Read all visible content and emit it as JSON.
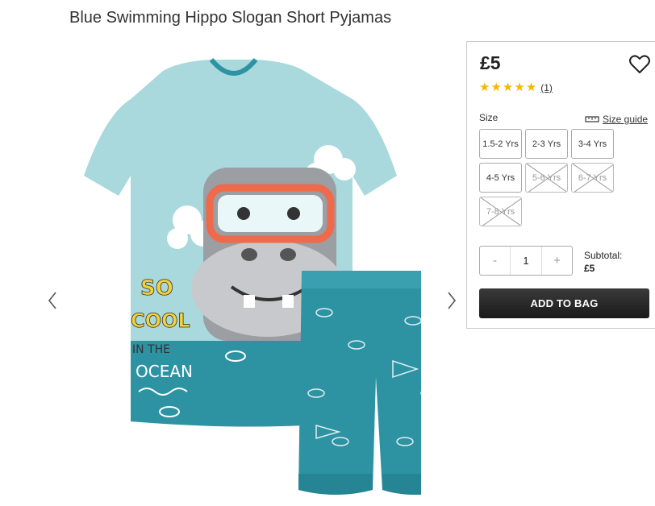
{
  "product": {
    "title": "Blue Swimming Hippo Slogan Short Pyjamas",
    "price": "£5",
    "rating": {
      "stars": 5,
      "review_count": "(1)"
    },
    "size_label": "Size",
    "size_guide_label": "Size guide",
    "sizes": [
      {
        "label": "1.5-2 Yrs",
        "available": true
      },
      {
        "label": "2-3 Yrs",
        "available": true
      },
      {
        "label": "3-4 Yrs",
        "available": true
      },
      {
        "label": "4-5 Yrs",
        "available": true
      },
      {
        "label": "5-6 Yrs",
        "available": false
      },
      {
        "label": "6-7 Yrs",
        "available": false
      },
      {
        "label": "7-8 Yrs",
        "available": false
      }
    ],
    "quantity": {
      "minus": "-",
      "value": "1",
      "plus": "+"
    },
    "subtotal_label": "Subtotal:",
    "subtotal_value": "£5",
    "add_to_bag_label": "ADD TO BAG"
  },
  "image_text": {
    "slogan_line1": "SO",
    "slogan_line2": "COOL",
    "slogan_line3": "IN THE",
    "slogan_line4": "OCEAN"
  },
  "colors": {
    "tshirt": "#a9d9dc",
    "shorts": "#2d93a3",
    "ocean": "#2d93a3",
    "hippo": "#9b9ea3",
    "mask": "#ef6a4a",
    "star": "#f5b800",
    "button": "#262626"
  },
  "icons": {
    "prev": "chevron-left-icon",
    "next": "chevron-right-icon",
    "wishlist": "heart-icon",
    "size_guide": "ruler-icon"
  }
}
